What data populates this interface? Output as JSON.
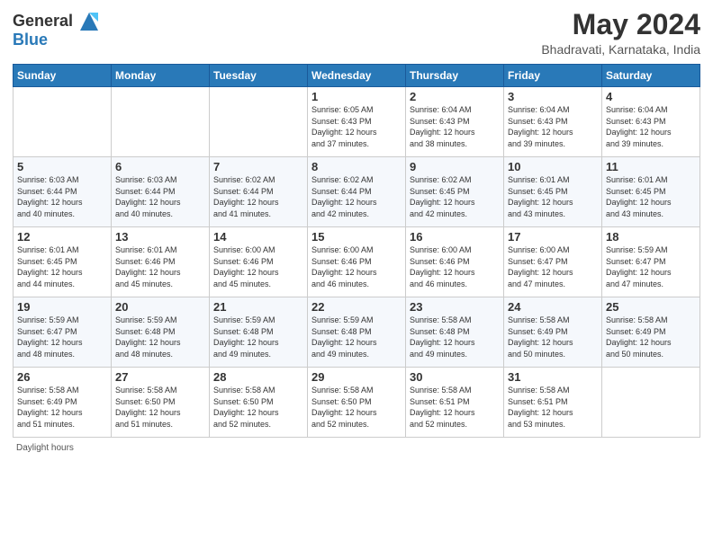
{
  "header": {
    "logo_line1": "General",
    "logo_line2": "Blue",
    "month_title": "May 2024",
    "subtitle": "Bhadravati, Karnataka, India"
  },
  "days_of_week": [
    "Sunday",
    "Monday",
    "Tuesday",
    "Wednesday",
    "Thursday",
    "Friday",
    "Saturday"
  ],
  "weeks": [
    [
      {
        "day": "",
        "info": ""
      },
      {
        "day": "",
        "info": ""
      },
      {
        "day": "",
        "info": ""
      },
      {
        "day": "1",
        "info": "Sunrise: 6:05 AM\nSunset: 6:43 PM\nDaylight: 12 hours\nand 37 minutes."
      },
      {
        "day": "2",
        "info": "Sunrise: 6:04 AM\nSunset: 6:43 PM\nDaylight: 12 hours\nand 38 minutes."
      },
      {
        "day": "3",
        "info": "Sunrise: 6:04 AM\nSunset: 6:43 PM\nDaylight: 12 hours\nand 39 minutes."
      },
      {
        "day": "4",
        "info": "Sunrise: 6:04 AM\nSunset: 6:43 PM\nDaylight: 12 hours\nand 39 minutes."
      }
    ],
    [
      {
        "day": "5",
        "info": "Sunrise: 6:03 AM\nSunset: 6:44 PM\nDaylight: 12 hours\nand 40 minutes."
      },
      {
        "day": "6",
        "info": "Sunrise: 6:03 AM\nSunset: 6:44 PM\nDaylight: 12 hours\nand 40 minutes."
      },
      {
        "day": "7",
        "info": "Sunrise: 6:02 AM\nSunset: 6:44 PM\nDaylight: 12 hours\nand 41 minutes."
      },
      {
        "day": "8",
        "info": "Sunrise: 6:02 AM\nSunset: 6:44 PM\nDaylight: 12 hours\nand 42 minutes."
      },
      {
        "day": "9",
        "info": "Sunrise: 6:02 AM\nSunset: 6:45 PM\nDaylight: 12 hours\nand 42 minutes."
      },
      {
        "day": "10",
        "info": "Sunrise: 6:01 AM\nSunset: 6:45 PM\nDaylight: 12 hours\nand 43 minutes."
      },
      {
        "day": "11",
        "info": "Sunrise: 6:01 AM\nSunset: 6:45 PM\nDaylight: 12 hours\nand 43 minutes."
      }
    ],
    [
      {
        "day": "12",
        "info": "Sunrise: 6:01 AM\nSunset: 6:45 PM\nDaylight: 12 hours\nand 44 minutes."
      },
      {
        "day": "13",
        "info": "Sunrise: 6:01 AM\nSunset: 6:46 PM\nDaylight: 12 hours\nand 45 minutes."
      },
      {
        "day": "14",
        "info": "Sunrise: 6:00 AM\nSunset: 6:46 PM\nDaylight: 12 hours\nand 45 minutes."
      },
      {
        "day": "15",
        "info": "Sunrise: 6:00 AM\nSunset: 6:46 PM\nDaylight: 12 hours\nand 46 minutes."
      },
      {
        "day": "16",
        "info": "Sunrise: 6:00 AM\nSunset: 6:46 PM\nDaylight: 12 hours\nand 46 minutes."
      },
      {
        "day": "17",
        "info": "Sunrise: 6:00 AM\nSunset: 6:47 PM\nDaylight: 12 hours\nand 47 minutes."
      },
      {
        "day": "18",
        "info": "Sunrise: 5:59 AM\nSunset: 6:47 PM\nDaylight: 12 hours\nand 47 minutes."
      }
    ],
    [
      {
        "day": "19",
        "info": "Sunrise: 5:59 AM\nSunset: 6:47 PM\nDaylight: 12 hours\nand 48 minutes."
      },
      {
        "day": "20",
        "info": "Sunrise: 5:59 AM\nSunset: 6:48 PM\nDaylight: 12 hours\nand 48 minutes."
      },
      {
        "day": "21",
        "info": "Sunrise: 5:59 AM\nSunset: 6:48 PM\nDaylight: 12 hours\nand 49 minutes."
      },
      {
        "day": "22",
        "info": "Sunrise: 5:59 AM\nSunset: 6:48 PM\nDaylight: 12 hours\nand 49 minutes."
      },
      {
        "day": "23",
        "info": "Sunrise: 5:58 AM\nSunset: 6:48 PM\nDaylight: 12 hours\nand 49 minutes."
      },
      {
        "day": "24",
        "info": "Sunrise: 5:58 AM\nSunset: 6:49 PM\nDaylight: 12 hours\nand 50 minutes."
      },
      {
        "day": "25",
        "info": "Sunrise: 5:58 AM\nSunset: 6:49 PM\nDaylight: 12 hours\nand 50 minutes."
      }
    ],
    [
      {
        "day": "26",
        "info": "Sunrise: 5:58 AM\nSunset: 6:49 PM\nDaylight: 12 hours\nand 51 minutes."
      },
      {
        "day": "27",
        "info": "Sunrise: 5:58 AM\nSunset: 6:50 PM\nDaylight: 12 hours\nand 51 minutes."
      },
      {
        "day": "28",
        "info": "Sunrise: 5:58 AM\nSunset: 6:50 PM\nDaylight: 12 hours\nand 52 minutes."
      },
      {
        "day": "29",
        "info": "Sunrise: 5:58 AM\nSunset: 6:50 PM\nDaylight: 12 hours\nand 52 minutes."
      },
      {
        "day": "30",
        "info": "Sunrise: 5:58 AM\nSunset: 6:51 PM\nDaylight: 12 hours\nand 52 minutes."
      },
      {
        "day": "31",
        "info": "Sunrise: 5:58 AM\nSunset: 6:51 PM\nDaylight: 12 hours\nand 53 minutes."
      },
      {
        "day": "",
        "info": ""
      }
    ]
  ],
  "footer": {
    "text": "Daylight hours"
  }
}
